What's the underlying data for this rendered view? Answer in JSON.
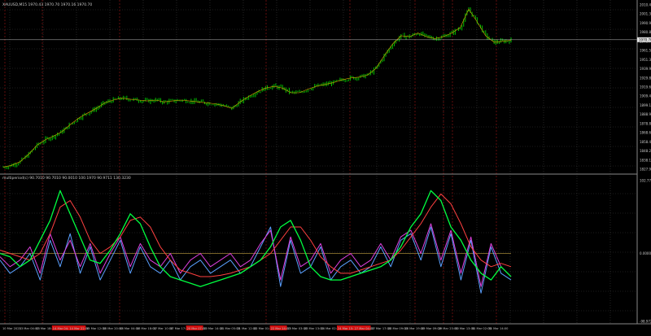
{
  "window": {
    "title": "XAUUSD,M15 1970.43 1970.70 1970.16 1970.70"
  },
  "indicator": {
    "title": "multiperiod(c)  90.7010 90.7010 90.0010 100.1970 90.9711 130.3230"
  },
  "colors": {
    "background": "#000000",
    "grid": "#3a3a3a",
    "session_line": "#7a1010",
    "candle_up": "#00c000",
    "candle_down": "#00c000",
    "price_line": "#c0c0c0",
    "osc_green": "#00ff40",
    "osc_red": "#ff4040",
    "osc_blue": "#5aa0ff",
    "osc_magenta": "#e040e0",
    "zero_line": "#c0a040",
    "axis_text": "#c8c8c8",
    "date_highlight": "#d01010"
  },
  "price_axis": {
    "labels": [
      "2010.40",
      "2001.30",
      "1990.95",
      "1980.80",
      "1970.70",
      "1961.50",
      "1951.35",
      "1939.95",
      "1929.80",
      "1919.65",
      "1909.40",
      "1899.10",
      "1888.95",
      "1878.80",
      "1868.65",
      "1858.40",
      "1848.25",
      "1838.10",
      "1827.95"
    ],
    "current": "1970.70"
  },
  "osc_axis": {
    "labels": [
      "102.7771",
      "0.0000",
      "-98.9720"
    ]
  },
  "time_axis": {
    "labels": [
      "10 Mar 2023",
      "13 Mar 04:00",
      "13 Mar 18:00",
      "14 Mar 04:00",
      "14 Mar 22:00",
      "15 Mar 12:00",
      "15 Mar 20:00",
      "16 Mar 04:00",
      "16 Mar 18:00",
      "17 Mar 10:00",
      "17 Mar 17:00",
      "20 Mar 07:00",
      "20 Mar 14:00",
      "21 Mar 05:00",
      "21 Mar 12:00",
      "22 Mar 01:00",
      "22 Mar 14:00",
      "23 Mar 03:00",
      "23 Mar 13:00",
      "24 Mar 02:00",
      "24 Mar 15:00",
      "27 Mar 04:00",
      "27 Mar 17:00",
      "28 Mar 09:00",
      "28 Mar 19:00",
      "29 Mar 09:00",
      "29 Mar 23:00",
      "30 Mar 13:00",
      "31 Mar 02:00",
      "31 Mar 14:00"
    ]
  },
  "chart_data": [
    {
      "type": "line",
      "title": "XAUUSD,M15 1970.43 1970.70 1970.16 1970.70",
      "ylim": [
        1827.95,
        2010.4
      ],
      "series": [
        {
          "name": "XAUUSD,M15",
          "values": [
            1832,
            1834,
            1838,
            1846,
            1856,
            1862,
            1866,
            1871,
            1879,
            1886,
            1891,
            1896,
            1902,
            1905,
            1907,
            1906,
            1905,
            1904,
            1905,
            1903,
            1904,
            1905,
            1904,
            1903,
            1902,
            1901,
            1899,
            1896,
            1903,
            1909,
            1914,
            1918,
            1920,
            1918,
            1913,
            1913,
            1917,
            1920,
            1922,
            1924,
            1927,
            1929,
            1930,
            1932,
            1939,
            1953,
            1966,
            1975,
            1974,
            1978,
            1974,
            1972,
            1974,
            1978,
            1984,
            2004,
            1990,
            1975,
            1968,
            1969,
            1970
          ]
        }
      ]
    },
    {
      "type": "line",
      "title": "multiperiod(c)  90.7010 90.7010 90.0010 100.1970 90.9711 130.3230",
      "ylim": [
        -98.972,
        102.7771
      ],
      "series": [
        {
          "name": "green",
          "values": [
            0,
            -5,
            -20,
            -10,
            20,
            50,
            95,
            60,
            25,
            -10,
            -15,
            5,
            30,
            60,
            45,
            10,
            -20,
            -35,
            -40,
            -45,
            -50,
            -45,
            -40,
            -35,
            -30,
            -20,
            -10,
            10,
            40,
            50,
            20,
            -20,
            -35,
            -40,
            -40,
            -35,
            -30,
            -25,
            -20,
            -10,
            10,
            40,
            60,
            95,
            80,
            40,
            20,
            -10,
            -30,
            -40,
            -20,
            -35
          ]
        },
        {
          "name": "red",
          "values": [
            5,
            0,
            -5,
            -10,
            0,
            30,
            70,
            80,
            55,
            20,
            0,
            10,
            25,
            50,
            55,
            40,
            10,
            -10,
            -25,
            -30,
            -35,
            -35,
            -33,
            -30,
            -25,
            -20,
            -10,
            0,
            20,
            40,
            40,
            20,
            -5,
            -20,
            -30,
            -30,
            -25,
            -20,
            -15,
            -10,
            5,
            25,
            45,
            70,
            90,
            75,
            45,
            10,
            -10,
            -20,
            -15,
            -20
          ]
        },
        {
          "name": "blue",
          "values": [
            -10,
            -30,
            -20,
            0,
            -40,
            20,
            -20,
            30,
            -30,
            10,
            -40,
            -10,
            20,
            -30,
            10,
            -20,
            -30,
            -10,
            -40,
            -20,
            -10,
            -30,
            -20,
            -10,
            -30,
            -20,
            10,
            40,
            -50,
            20,
            -30,
            -20,
            10,
            -40,
            -20,
            -10,
            -30,
            -20,
            10,
            -20,
            20,
            30,
            -10,
            40,
            -20,
            30,
            -40,
            20,
            -60,
            10,
            -30,
            -40
          ]
        },
        {
          "name": "magenta",
          "values": [
            -5,
            -20,
            -10,
            10,
            -30,
            30,
            -10,
            20,
            -20,
            15,
            -30,
            0,
            25,
            -20,
            15,
            -10,
            -20,
            0,
            -30,
            -10,
            0,
            -20,
            -10,
            0,
            -20,
            -10,
            15,
            35,
            -40,
            25,
            -20,
            -10,
            15,
            -30,
            -10,
            0,
            -20,
            -10,
            15,
            -10,
            25,
            35,
            0,
            45,
            -10,
            35,
            -30,
            25,
            -50,
            15,
            -20,
            -35
          ]
        }
      ]
    }
  ]
}
